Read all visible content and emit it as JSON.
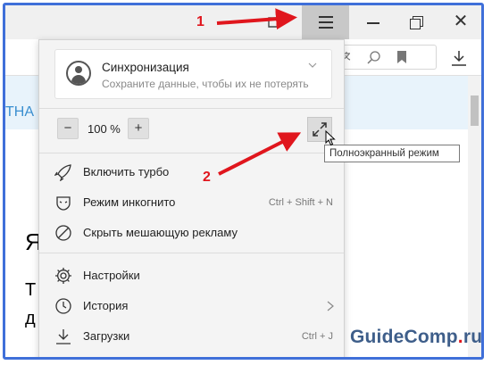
{
  "window": {
    "minimize_icon": "minimize-icon",
    "maximize_icon": "restore-icon",
    "close_glyph": "✕",
    "menu_icon": "hamburger-icon"
  },
  "background_page": {
    "strip_text": "ТНА",
    "fragments": [
      "Я",
      "Т",
      "д"
    ]
  },
  "menu": {
    "sync": {
      "title": "Синхронизация",
      "subtitle": "Сохраните данные, чтобы их не потерять"
    },
    "zoom": {
      "minus": "−",
      "value": "100 %",
      "plus": "+"
    },
    "items_group1": [
      {
        "label": "Включить турбо",
        "icon": "turbo-rocket-icon",
        "shortcut": ""
      },
      {
        "label": "Режим инкогнито",
        "icon": "incognito-mask-icon",
        "shortcut": "Ctrl + Shift + N"
      },
      {
        "label": "Скрыть мешающую рекламу",
        "icon": "block-ads-icon",
        "shortcut": ""
      }
    ],
    "items_group2": [
      {
        "label": "Настройки",
        "icon": "gear-icon",
        "shortcut": ""
      },
      {
        "label": "История",
        "icon": "clock-icon",
        "shortcut": ""
      },
      {
        "label": "Загрузки",
        "icon": "download-icon",
        "shortcut": "Ctrl + J"
      }
    ]
  },
  "tooltip": "Полноэкранный режим",
  "annotations": {
    "label1": "1",
    "label2": "2",
    "color": "#e0161d"
  },
  "watermark": {
    "name": "GuideComp",
    "dot": ".",
    "tld": "ru"
  },
  "colors": {
    "frame": "#3f6fd9",
    "menu_bg": "#f4f4f4",
    "menu_button_active": "#c8c8c8"
  }
}
